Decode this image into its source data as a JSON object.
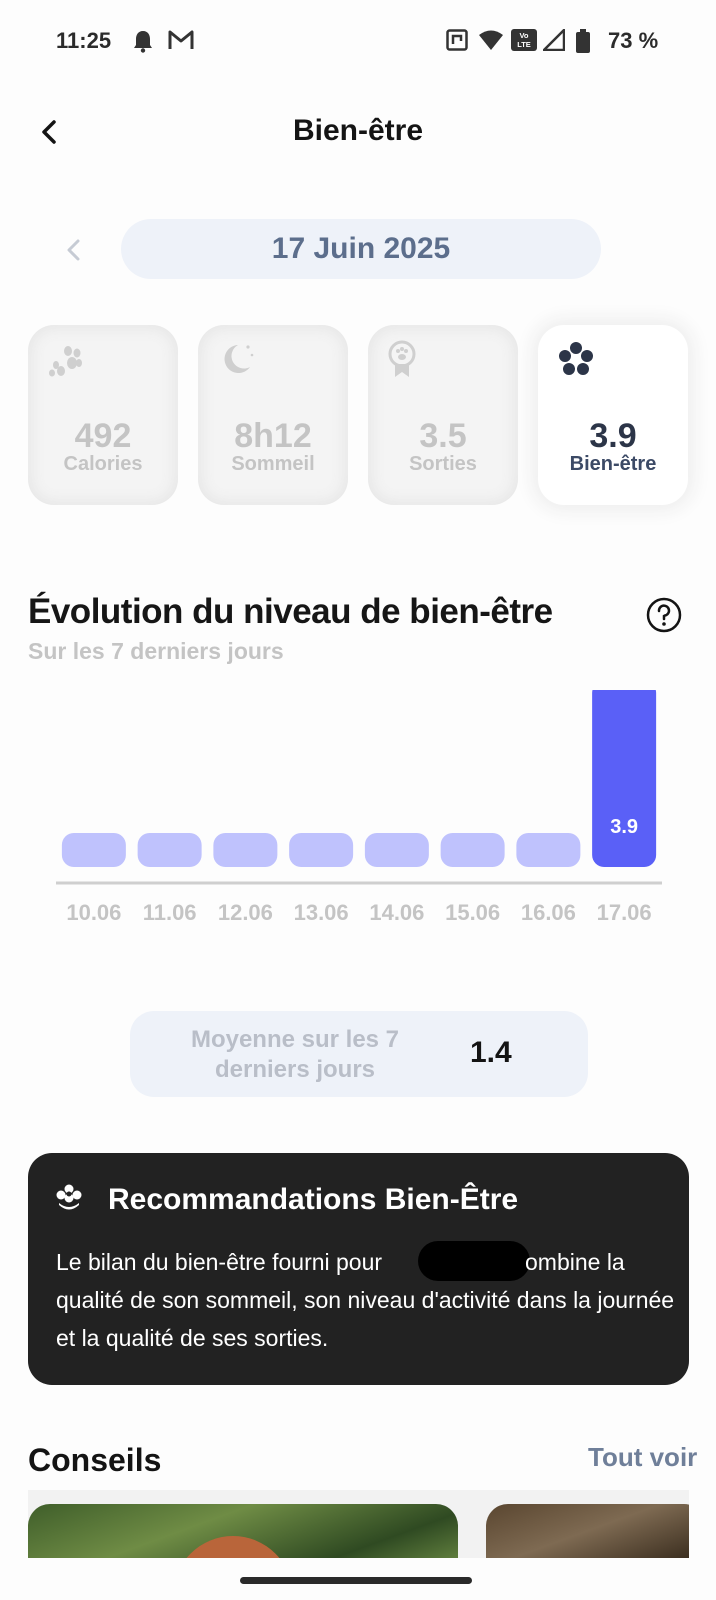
{
  "status_bar": {
    "time": "11:25",
    "battery_text": "73 %",
    "left_icons": [
      "bell-icon",
      "gmail-icon"
    ],
    "right_icons": [
      "nfc-icon",
      "wifi-icon",
      "volte-icon",
      "signal-icon",
      "battery-icon"
    ]
  },
  "header": {
    "title": "Bien-être",
    "back_icon": "chevron-left-icon"
  },
  "date_selector": {
    "date": "17 Juin 2025",
    "prev_icon": "chevron-left-icon"
  },
  "stats": [
    {
      "value": "492",
      "label": "Calories",
      "icon": "paw-icon",
      "active": false
    },
    {
      "value": "8h12",
      "label": "Sommeil",
      "icon": "moon-icon",
      "active": false
    },
    {
      "value": "3.5",
      "label": "Sorties",
      "icon": "award-paw-icon",
      "active": false
    },
    {
      "value": "3.9",
      "label": "Bien-être",
      "icon": "flower-icon",
      "active": true
    }
  ],
  "section": {
    "title": "Évolution du niveau de bien-être",
    "subtitle": "Sur les 7 derniers jours",
    "help_icon": "question-circle-icon"
  },
  "chart_data": {
    "type": "bar",
    "categories": [
      "10.06",
      "11.06",
      "12.06",
      "13.06",
      "14.06",
      "15.06",
      "16.06",
      "17.06"
    ],
    "values": [
      0,
      0,
      0,
      0,
      0,
      0,
      0,
      3.9
    ],
    "value_labels": [
      "",
      "",
      "",
      "",
      "",
      "",
      "",
      "3.9"
    ],
    "title": "",
    "xlabel": "",
    "ylabel": "",
    "colors": {
      "highlight": "#5a60f7",
      "muted": "#bfc2fd",
      "axis": "#cfcfcf",
      "tick": "#c4c4c4"
    }
  },
  "average": {
    "label": "Moyenne sur les 7 derniers jours",
    "value": "1.4"
  },
  "recommendation": {
    "icon": "flower-icon",
    "title": "Recommandations Bien-Être",
    "text_line1_start": "Le bilan du bien-être fourni pour",
    "text_line1_end": "ombine la",
    "text_rest": "qualité de son sommeil, son niveau d'activité dans la journée et la qualité de ses sorties."
  },
  "tips": {
    "title": "Conseils",
    "see_all": "Tout voir"
  },
  "colors": {
    "accent": "#5a60f7",
    "pill_bg": "#eef2f9",
    "date_text": "#5c6e8c",
    "reco_bg": "#222222"
  }
}
